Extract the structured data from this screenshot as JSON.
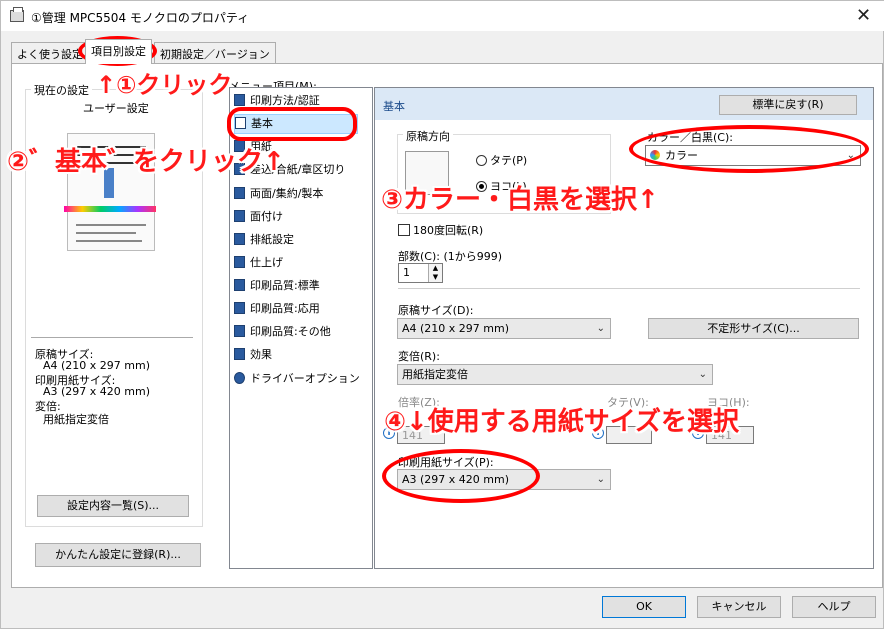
{
  "window": {
    "title": "①管理 MPC5504 モノクロのプロパティ",
    "close_glyph": "✕"
  },
  "tabs": [
    {
      "label": "よく使う設定"
    },
    {
      "label": "項目別設定"
    },
    {
      "label": "初期設定／バージョン"
    }
  ],
  "left_panel": {
    "group_title": "現在の設定",
    "current": "ユーザー設定",
    "summary": {
      "original_size_label": "原稿サイズ:",
      "original_size_value": "A4 (210 x 297 mm)",
      "paper_size_label": "印刷用紙サイズ:",
      "paper_size_value": "A3 (297 x 420 mm)",
      "scale_label": "変倍:",
      "scale_value": "用紙指定変倍"
    },
    "settings_list_button": "設定内容一覧(S)...",
    "register_button": "かんたん設定に登録(R)..."
  },
  "menu": {
    "label": "メニュー項目(M):",
    "items": [
      {
        "label": "印刷方法/認証"
      },
      {
        "label": "基本"
      },
      {
        "label": "用紙"
      },
      {
        "label": "差込/合紙/章区切り"
      },
      {
        "label": "両面/集約/製本"
      },
      {
        "label": "面付け"
      },
      {
        "label": "排紙設定"
      },
      {
        "label": "仕上げ"
      },
      {
        "label": "印刷品質:標準"
      },
      {
        "label": "印刷品質:応用"
      },
      {
        "label": "印刷品質:その他"
      },
      {
        "label": "効果"
      },
      {
        "label": "ドライバーオプション"
      }
    ]
  },
  "basic": {
    "header": "基本",
    "restore_button": "標準に戻す(R)",
    "orientation_label": "原稿方向",
    "portrait": "タテ(P)",
    "landscape": "ヨコ(L)",
    "rotate180": "180度回転(R)",
    "color_label": "カラー／白黒(C):",
    "color_value": "カラー",
    "copies_label": "部数(C): (1から999)",
    "copies_value": "1",
    "original_size_label": "原稿サイズ(D):",
    "original_size_value": "A4 (210 x 297 mm)",
    "custom_size_button": "不定形サイズ(C)...",
    "scale_label": "変倍(R):",
    "scale_value": "用紙指定変倍",
    "ratio_label": "倍率(Z):",
    "ratio_value": "141",
    "vertical_label": "タテ(V):",
    "horizontal_label": "ヨコ(H):",
    "horizontal_value": "141",
    "paper_size_label": "印刷用紙サイズ(P):",
    "paper_size_value": "A3 (297 x 420 mm)"
  },
  "footer": {
    "ok": "OK",
    "cancel": "キャンセル",
    "help": "ヘルプ"
  },
  "annotations": {
    "step1": "↑①クリック",
    "step2": "②゛基本゛をクリック↑",
    "step3": "③カラー・白黒を選択↑",
    "step4": "④↓使用する用紙サイズを選択"
  },
  "colors": {
    "annotation_red": "#ff1a1a",
    "selection_blue": "#cce8ff",
    "header_blue": "#dbe8f6"
  }
}
